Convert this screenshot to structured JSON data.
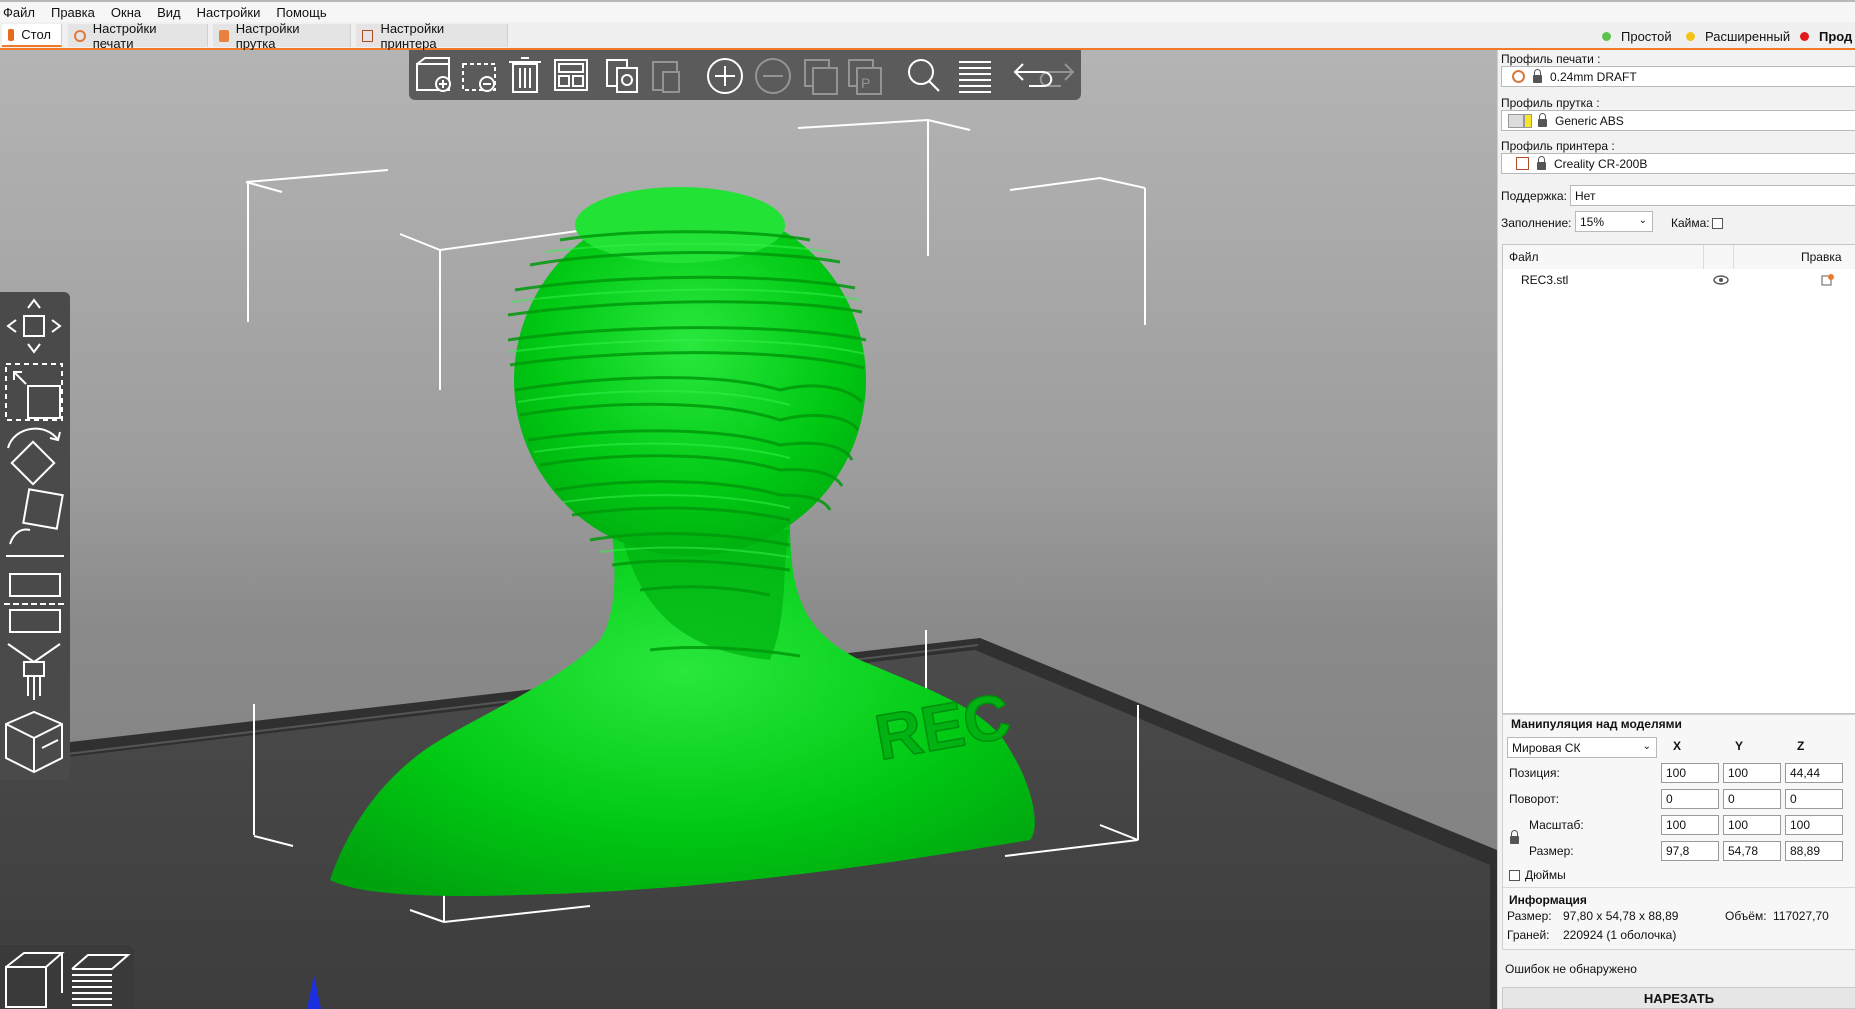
{
  "menu": [
    "Файл",
    "Правка",
    "Окна",
    "Вид",
    "Настройки",
    "Помощь"
  ],
  "tabs": [
    {
      "label": "Стол",
      "active": true
    },
    {
      "label": "Настройки печати",
      "active": false
    },
    {
      "label": "Настройки прутка",
      "active": false
    },
    {
      "label": "Настройки принтера",
      "active": false
    }
  ],
  "modes": [
    {
      "label": "Простой",
      "color": "#5cc44d"
    },
    {
      "label": "Расширенный",
      "color": "#f2c417"
    },
    {
      "label": "Прод",
      "color": "#e11b1b"
    }
  ],
  "model": {
    "color": "#00d11a",
    "emboss_text": "REC"
  },
  "right": {
    "print_profile_label": "Профиль печати :",
    "print_profile_value": "0.24mm DRAFT",
    "filament_profile_label": "Профиль прутка :",
    "filament_profile_value": "Generic ABS",
    "printer_profile_label": "Профиль принтера :",
    "printer_profile_value": "Creality CR-200B",
    "support_label": "Поддержка:",
    "support_value": "Нет",
    "infill_label": "Заполнение:",
    "infill_value": "15%",
    "brim_label": "Кайма:",
    "file_col": "Файл",
    "edit_col": "Правка",
    "file_name": "REC3.stl"
  },
  "manip": {
    "title": "Манипуляция над моделями",
    "cs_value": "Мировая СК",
    "x": "X",
    "y": "Y",
    "z": "Z",
    "pos_label": "Позиция:",
    "pos": [
      "100",
      "100",
      "44,44"
    ],
    "rot_label": "Поворот:",
    "rot": [
      "0",
      "0",
      "0"
    ],
    "scale_label": "Масштаб:",
    "scale": [
      "100",
      "100",
      "100"
    ],
    "size_label": "Размер:",
    "size": [
      "97,8",
      "54,78",
      "88,89"
    ],
    "inches_label": "Дюймы"
  },
  "info": {
    "title": "Информация",
    "size_label": "Размер:",
    "size_value": "97,80 x 54,78 x 88,89",
    "volume_label": "Объём:",
    "volume_value": "117027,70",
    "faces_label": "Граней:",
    "faces_value": "220924 (1 оболочка)",
    "errors_text": "Ошибок не обнаружено"
  },
  "slice_label": "НАРЕЗАТЬ",
  "icons": {
    "toolbar": [
      "add-icon",
      "delete-icon",
      "delete-all-icon",
      "arrange-icon",
      "copy-icon",
      "paste-icon",
      "instance-add-icon",
      "instance-remove-icon",
      "split-objects-icon",
      "split-parts-icon",
      "search-icon",
      "layers-icon",
      "undo-icon",
      "redo-icon"
    ],
    "sidebar": [
      "move-icon",
      "scale-icon",
      "rotate-icon",
      "place-on-face-icon",
      "cut-icon",
      "paint-supports-icon",
      "seam-icon"
    ]
  }
}
